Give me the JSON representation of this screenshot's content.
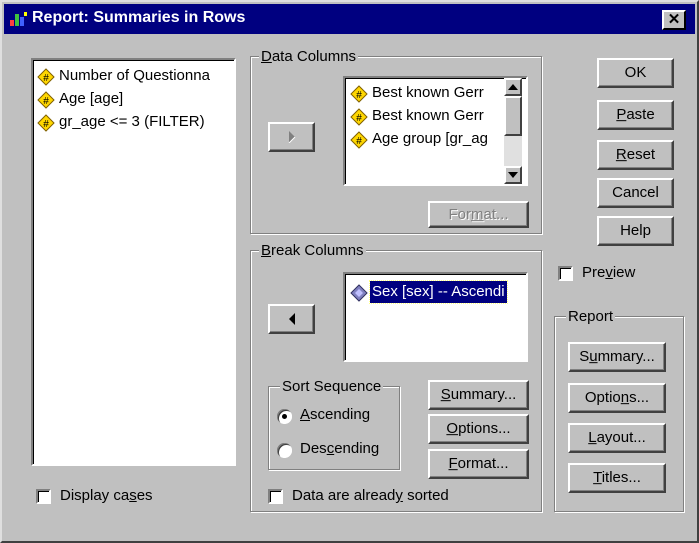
{
  "window": {
    "title": "Report: Summaries in Rows",
    "close_glyph": "✕"
  },
  "variables_list": {
    "items": [
      {
        "label": "Number of Questionna"
      },
      {
        "label": "Age [age]"
      },
      {
        "label": "gr_age <= 3 (FILTER)"
      }
    ]
  },
  "data_columns": {
    "label_prefix": "",
    "label_hotkey": "D",
    "label_rest": "ata Columns",
    "items": [
      {
        "label": "Best known Gerr"
      },
      {
        "label": "Best known Gerr"
      },
      {
        "label": "Age group [gr_ag"
      }
    ],
    "format_button": {
      "pre": "For",
      "hotkey": "m",
      "post": "at..."
    }
  },
  "break_columns": {
    "label_prefix": "",
    "label_hotkey": "B",
    "label_rest": "reak Columns",
    "items": [
      {
        "label": "Sex [sex] -- Ascendi",
        "selected": true
      }
    ],
    "sort_sequence": {
      "label": "Sort Sequence",
      "ascending": {
        "hotkey": "A",
        "rest": "scending",
        "checked": true
      },
      "descending": {
        "pre": "Des",
        "hotkey": "c",
        "post": "ending",
        "checked": false
      }
    },
    "summary_button": {
      "hotkey": "S",
      "rest": "ummary..."
    },
    "options_button": {
      "hotkey": "O",
      "rest": "ptions..."
    },
    "format_button": {
      "hotkey": "F",
      "rest": "ormat..."
    },
    "sorted_checkbox": {
      "pre": "Data are alread",
      "hotkey": "y",
      "post": " sorted",
      "checked": false
    }
  },
  "display_cases": {
    "pre": "Display ca",
    "hotkey": "s",
    "post": "es",
    "checked": false
  },
  "buttons": {
    "ok": "OK",
    "paste": {
      "hotkey": "P",
      "rest": "aste"
    },
    "reset": {
      "hotkey": "R",
      "rest": "eset"
    },
    "cancel": "Cancel",
    "help": "Help"
  },
  "preview": {
    "pre": "Pre",
    "hotkey": "v",
    "post": "iew",
    "checked": false
  },
  "report_group": {
    "label": "Report",
    "summary": {
      "pre": "S",
      "hotkey": "u",
      "post": "mmary..."
    },
    "options": {
      "pre": "Optio",
      "hotkey": "n",
      "post": "s..."
    },
    "layout": {
      "pre": "",
      "hotkey": "L",
      "post": "ayout..."
    },
    "titles": {
      "pre": "",
      "hotkey": "T",
      "post": "itles..."
    }
  },
  "colors": {
    "titlebar": "#000080",
    "face": "#c0c0c0",
    "selection": "#000080",
    "var_icon": "#ffd700"
  },
  "icons": {
    "variable": "scale-variable-icon",
    "nominal": "nominal-variable-icon"
  }
}
